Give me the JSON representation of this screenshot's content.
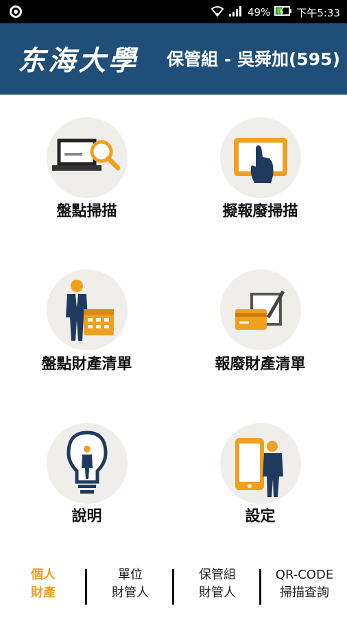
{
  "statusbar": {
    "battery": "49%",
    "time": "下午5:33"
  },
  "header": {
    "logo": "东海大學",
    "user": "保管組 - 吳舜加(595)"
  },
  "menu": [
    {
      "label": "盤點掃描",
      "icon": "laptop-search-icon"
    },
    {
      "label": "擬報廢掃描",
      "icon": "tablet-touch-icon"
    },
    {
      "label": "盤點財產清單",
      "icon": "person-calendar-icon"
    },
    {
      "label": "報廢財產清單",
      "icon": "card-document-icon"
    },
    {
      "label": "說明",
      "icon": "lightbulb-person-icon"
    },
    {
      "label": "設定",
      "icon": "phone-person-icon"
    }
  ],
  "tabs": [
    {
      "line1": "個人",
      "line2": "財產",
      "active": true
    },
    {
      "line1": "單位",
      "line2": "財管人",
      "active": false
    },
    {
      "line1": "保管組",
      "line2": "財管人",
      "active": false
    },
    {
      "line1": "QR-CODE",
      "line2": "掃描查詢",
      "active": false
    }
  ],
  "colors": {
    "header": "#1f4e79",
    "accent": "#f0a020",
    "navy": "#1f3a5f"
  }
}
